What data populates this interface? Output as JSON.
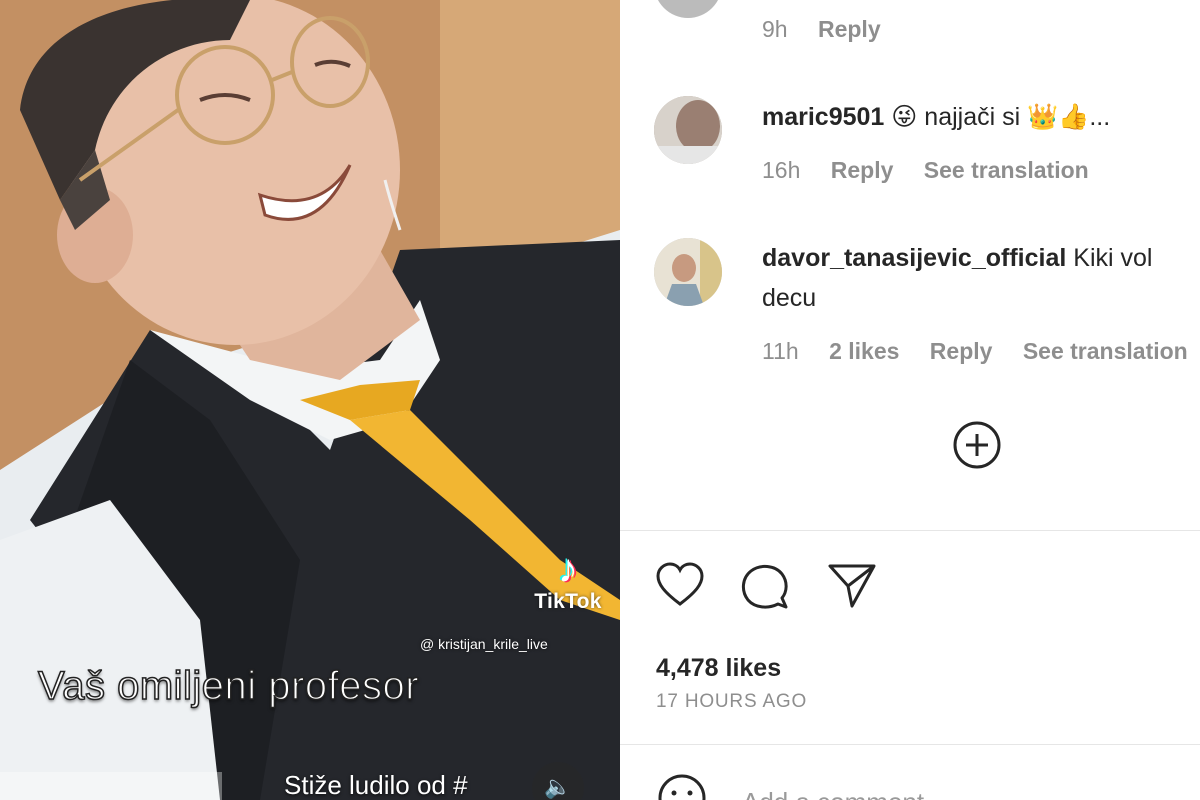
{
  "video": {
    "tiktok_logo_glyph": "♪",
    "tiktok_label": "TikTok",
    "handle": "@ kristijan_krile_live",
    "caption": "Vaš omiljeni profesor",
    "subcaption": "Stiže ludilo od #",
    "sound_icon": "speaker-icon"
  },
  "comments": {
    "top_meta": {
      "time": "9h",
      "reply": "Reply"
    },
    "items": [
      {
        "username": "maric9501",
        "text": "😜 najjači si 👑👍...",
        "time": "16h",
        "reply": "Reply",
        "translate": "See translation"
      },
      {
        "username": "davor_tanasijevic_official",
        "text": "Kiki vol",
        "text_line2": "decu",
        "time": "11h",
        "likes": "2 likes",
        "reply": "Reply",
        "translate": "See translation"
      }
    ],
    "load_more_icon": "plus-circle-icon"
  },
  "actions": {
    "icons": [
      "heart-icon",
      "comment-icon",
      "share-icon"
    ],
    "likes": "4,478 likes",
    "time_ago": "17 HOURS AGO"
  },
  "add_comment": {
    "placeholder": "Add a comment..."
  },
  "colors": {
    "text": "#262626",
    "muted": "#8e8e8e",
    "tie": "#f2b632",
    "vest": "#25272c"
  }
}
